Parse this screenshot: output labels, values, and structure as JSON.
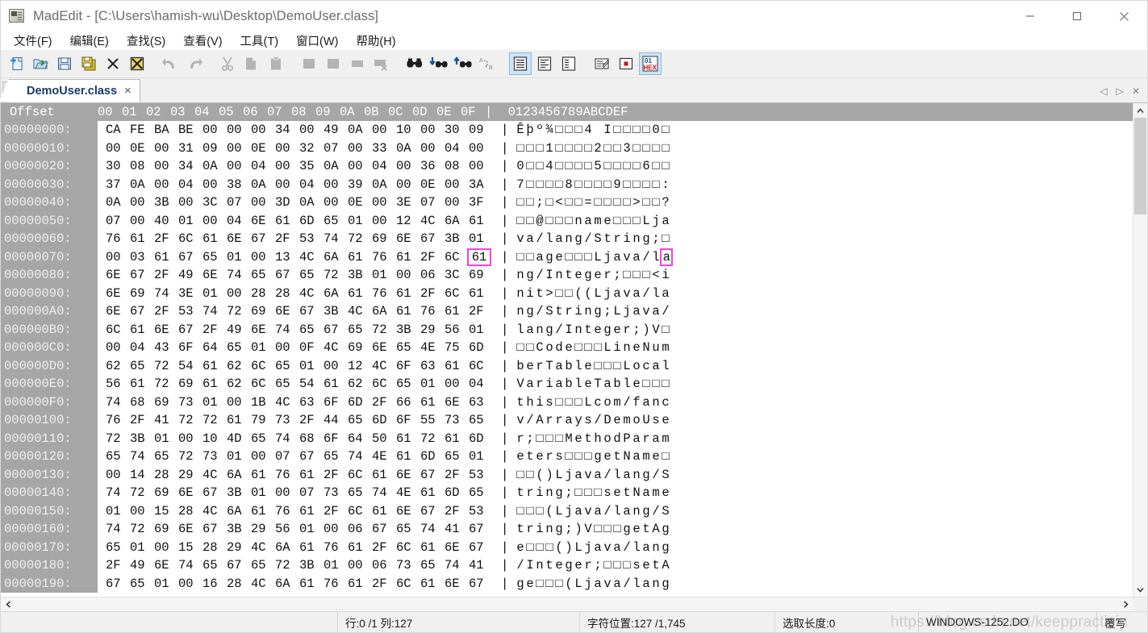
{
  "window": {
    "title": "MadEdit - [C:\\Users\\hamish-wu\\Desktop\\DemoUser.class]",
    "app_icon": "madedit-app-icon",
    "minimize_label": "—",
    "maximize_label": "☐",
    "close_label": "✕"
  },
  "menu": {
    "items": [
      {
        "label": "文件(F)"
      },
      {
        "label": "编辑(E)"
      },
      {
        "label": "查找(S)"
      },
      {
        "label": "查看(V)"
      },
      {
        "label": "工具(T)"
      },
      {
        "label": "窗口(W)"
      },
      {
        "label": "帮助(H)"
      }
    ]
  },
  "toolbar": {
    "items": [
      {
        "name": "new-file-icon",
        "enabled": true
      },
      {
        "name": "open-file-icon",
        "enabled": true
      },
      {
        "name": "save-file-icon",
        "enabled": true
      },
      {
        "name": "save-all-icon",
        "enabled": true
      },
      {
        "name": "close-file-icon",
        "enabled": true
      },
      {
        "name": "close-all-icon",
        "enabled": true
      },
      {
        "name": "separator-1",
        "separator": true
      },
      {
        "name": "undo-icon",
        "enabled": false
      },
      {
        "name": "redo-icon",
        "enabled": false
      },
      {
        "name": "separator-2",
        "separator": true
      },
      {
        "name": "cut-icon",
        "enabled": false
      },
      {
        "name": "copy-icon",
        "enabled": false
      },
      {
        "name": "paste-icon",
        "enabled": false
      },
      {
        "name": "separator-3",
        "separator": true
      },
      {
        "name": "indent-icon",
        "enabled": false
      },
      {
        "name": "unindent-icon",
        "enabled": false
      },
      {
        "name": "comment-icon",
        "enabled": false
      },
      {
        "name": "uncomment-icon",
        "enabled": false
      },
      {
        "name": "separator-4",
        "separator": true
      },
      {
        "name": "find-icon",
        "enabled": true
      },
      {
        "name": "find-next-icon",
        "enabled": true
      },
      {
        "name": "find-previous-icon",
        "enabled": true
      },
      {
        "name": "replace-icon",
        "enabled": true
      },
      {
        "name": "separator-5",
        "separator": true
      },
      {
        "name": "word-wrap-by-window-icon",
        "enabled": true,
        "active": true
      },
      {
        "name": "word-wrap-by-column-icon",
        "enabled": true
      },
      {
        "name": "no-word-wrap-icon",
        "enabled": true
      },
      {
        "name": "separator-6",
        "separator": true
      },
      {
        "name": "text-mode-icon",
        "enabled": true
      },
      {
        "name": "column-mode-icon",
        "enabled": true
      },
      {
        "name": "hex-mode-icon",
        "enabled": true,
        "active": true
      }
    ]
  },
  "tabs": {
    "left_stub": "",
    "items": [
      {
        "label": "DemoUser.class",
        "close": "×",
        "active": true
      }
    ],
    "nav_prev": "◁",
    "nav_next": "▷",
    "nav_close": "✕"
  },
  "hex_view": {
    "header": {
      "offset_label": "Offset",
      "byte_columns": [
        "00",
        "01",
        "02",
        "03",
        "04",
        "05",
        "06",
        "07",
        "08",
        "09",
        "0A",
        "0B",
        "0C",
        "0D",
        "0E",
        "0F"
      ],
      "separator": "|",
      "ascii_label": "0123456789ABCDEF"
    },
    "cursor": {
      "row_index": 7,
      "byte_index": 15,
      "color": "#ee44dd"
    },
    "rows": [
      {
        "offset": "00000000:",
        "bytes": [
          "CA",
          "FE",
          "BA",
          "BE",
          "00",
          "00",
          "00",
          "34",
          "00",
          "49",
          "0A",
          "00",
          "10",
          "00",
          "30",
          "09"
        ],
        "ascii": "Êþº¾□□□4 I□□□□0□"
      },
      {
        "offset": "00000010:",
        "bytes": [
          "00",
          "0E",
          "00",
          "31",
          "09",
          "00",
          "0E",
          "00",
          "32",
          "07",
          "00",
          "33",
          "0A",
          "00",
          "04",
          "00"
        ],
        "ascii": "□□□1□□□□2□□3□□□□"
      },
      {
        "offset": "00000020:",
        "bytes": [
          "30",
          "08",
          "00",
          "34",
          "0A",
          "00",
          "04",
          "00",
          "35",
          "0A",
          "00",
          "04",
          "00",
          "36",
          "08",
          "00"
        ],
        "ascii": "0□□4□□□□5□□□□6□□"
      },
      {
        "offset": "00000030:",
        "bytes": [
          "37",
          "0A",
          "00",
          "04",
          "00",
          "38",
          "0A",
          "00",
          "04",
          "00",
          "39",
          "0A",
          "00",
          "0E",
          "00",
          "3A"
        ],
        "ascii": "7□□□□8□□□□9□□□□:"
      },
      {
        "offset": "00000040:",
        "bytes": [
          "0A",
          "00",
          "3B",
          "00",
          "3C",
          "07",
          "00",
          "3D",
          "0A",
          "00",
          "0E",
          "00",
          "3E",
          "07",
          "00",
          "3F"
        ],
        "ascii": "□□;□<□□=□□□□>□□?"
      },
      {
        "offset": "00000050:",
        "bytes": [
          "07",
          "00",
          "40",
          "01",
          "00",
          "04",
          "6E",
          "61",
          "6D",
          "65",
          "01",
          "00",
          "12",
          "4C",
          "6A",
          "61"
        ],
        "ascii": "□□@□□□name□□□Lja"
      },
      {
        "offset": "00000060:",
        "bytes": [
          "76",
          "61",
          "2F",
          "6C",
          "61",
          "6E",
          "67",
          "2F",
          "53",
          "74",
          "72",
          "69",
          "6E",
          "67",
          "3B",
          "01"
        ],
        "ascii": "va/lang/String;□"
      },
      {
        "offset": "00000070:",
        "bytes": [
          "00",
          "03",
          "61",
          "67",
          "65",
          "01",
          "00",
          "13",
          "4C",
          "6A",
          "61",
          "76",
          "61",
          "2F",
          "6C",
          "61"
        ],
        "ascii": "□□age□□□Ljava/la"
      },
      {
        "offset": "00000080:",
        "bytes": [
          "6E",
          "67",
          "2F",
          "49",
          "6E",
          "74",
          "65",
          "67",
          "65",
          "72",
          "3B",
          "01",
          "00",
          "06",
          "3C",
          "69"
        ],
        "ascii": "ng/Integer;□□□<i"
      },
      {
        "offset": "00000090:",
        "bytes": [
          "6E",
          "69",
          "74",
          "3E",
          "01",
          "00",
          "28",
          "28",
          "4C",
          "6A",
          "61",
          "76",
          "61",
          "2F",
          "6C",
          "61"
        ],
        "ascii": "nit>□□((Ljava/la"
      },
      {
        "offset": "000000A0:",
        "bytes": [
          "6E",
          "67",
          "2F",
          "53",
          "74",
          "72",
          "69",
          "6E",
          "67",
          "3B",
          "4C",
          "6A",
          "61",
          "76",
          "61",
          "2F"
        ],
        "ascii": "ng/String;Ljava/"
      },
      {
        "offset": "000000B0:",
        "bytes": [
          "6C",
          "61",
          "6E",
          "67",
          "2F",
          "49",
          "6E",
          "74",
          "65",
          "67",
          "65",
          "72",
          "3B",
          "29",
          "56",
          "01"
        ],
        "ascii": "lang/Integer;)V□"
      },
      {
        "offset": "000000C0:",
        "bytes": [
          "00",
          "04",
          "43",
          "6F",
          "64",
          "65",
          "01",
          "00",
          "0F",
          "4C",
          "69",
          "6E",
          "65",
          "4E",
          "75",
          "6D"
        ],
        "ascii": "□□Code□□□LineNum"
      },
      {
        "offset": "000000D0:",
        "bytes": [
          "62",
          "65",
          "72",
          "54",
          "61",
          "62",
          "6C",
          "65",
          "01",
          "00",
          "12",
          "4C",
          "6F",
          "63",
          "61",
          "6C"
        ],
        "ascii": "berTable□□□Local"
      },
      {
        "offset": "000000E0:",
        "bytes": [
          "56",
          "61",
          "72",
          "69",
          "61",
          "62",
          "6C",
          "65",
          "54",
          "61",
          "62",
          "6C",
          "65",
          "01",
          "00",
          "04"
        ],
        "ascii": "VariableTable□□□"
      },
      {
        "offset": "000000F0:",
        "bytes": [
          "74",
          "68",
          "69",
          "73",
          "01",
          "00",
          "1B",
          "4C",
          "63",
          "6F",
          "6D",
          "2F",
          "66",
          "61",
          "6E",
          "63"
        ],
        "ascii": "this□□□Lcom/fanc"
      },
      {
        "offset": "00000100:",
        "bytes": [
          "76",
          "2F",
          "41",
          "72",
          "72",
          "61",
          "79",
          "73",
          "2F",
          "44",
          "65",
          "6D",
          "6F",
          "55",
          "73",
          "65"
        ],
        "ascii": "v/Arrays/DemoUse"
      },
      {
        "offset": "00000110:",
        "bytes": [
          "72",
          "3B",
          "01",
          "00",
          "10",
          "4D",
          "65",
          "74",
          "68",
          "6F",
          "64",
          "50",
          "61",
          "72",
          "61",
          "6D"
        ],
        "ascii": "r;□□□MethodParam"
      },
      {
        "offset": "00000120:",
        "bytes": [
          "65",
          "74",
          "65",
          "72",
          "73",
          "01",
          "00",
          "07",
          "67",
          "65",
          "74",
          "4E",
          "61",
          "6D",
          "65",
          "01"
        ],
        "ascii": "eters□□□getName□"
      },
      {
        "offset": "00000130:",
        "bytes": [
          "00",
          "14",
          "28",
          "29",
          "4C",
          "6A",
          "61",
          "76",
          "61",
          "2F",
          "6C",
          "61",
          "6E",
          "67",
          "2F",
          "53"
        ],
        "ascii": "□□()Ljava/lang/S"
      },
      {
        "offset": "00000140:",
        "bytes": [
          "74",
          "72",
          "69",
          "6E",
          "67",
          "3B",
          "01",
          "00",
          "07",
          "73",
          "65",
          "74",
          "4E",
          "61",
          "6D",
          "65"
        ],
        "ascii": "tring;□□□setName"
      },
      {
        "offset": "00000150:",
        "bytes": [
          "01",
          "00",
          "15",
          "28",
          "4C",
          "6A",
          "61",
          "76",
          "61",
          "2F",
          "6C",
          "61",
          "6E",
          "67",
          "2F",
          "53"
        ],
        "ascii": "□□□(Ljava/lang/S"
      },
      {
        "offset": "00000160:",
        "bytes": [
          "74",
          "72",
          "69",
          "6E",
          "67",
          "3B",
          "29",
          "56",
          "01",
          "00",
          "06",
          "67",
          "65",
          "74",
          "41",
          "67"
        ],
        "ascii": "tring;)V□□□getAg"
      },
      {
        "offset": "00000170:",
        "bytes": [
          "65",
          "01",
          "00",
          "15",
          "28",
          "29",
          "4C",
          "6A",
          "61",
          "76",
          "61",
          "2F",
          "6C",
          "61",
          "6E",
          "67"
        ],
        "ascii": "e□□□()Ljava/lang"
      },
      {
        "offset": "00000180:",
        "bytes": [
          "2F",
          "49",
          "6E",
          "74",
          "65",
          "67",
          "65",
          "72",
          "3B",
          "01",
          "00",
          "06",
          "73",
          "65",
          "74",
          "41"
        ],
        "ascii": "/Integer;□□□setA"
      },
      {
        "offset": "00000190:",
        "bytes": [
          "67",
          "65",
          "01",
          "00",
          "16",
          "28",
          "4C",
          "6A",
          "61",
          "76",
          "61",
          "2F",
          "6C",
          "61",
          "6E",
          "67"
        ],
        "ascii": "ge□□□(Ljava/lang"
      }
    ]
  },
  "scrollbars": {
    "v_up": "⌃",
    "v_down": "⌄",
    "h_left": "‹",
    "h_right": "›"
  },
  "statusbar": {
    "empty_left": "",
    "line_col": "行:0 /1 列:127",
    "char_pos": "字符位置:127 /1,745",
    "sel_len": "选取长度:0",
    "encoding": "WINDOWS-1252.DO",
    "overwrite_mode": "覆写"
  },
  "watermark": {
    "text": "https://blog.csdn.net/keeppracticin"
  }
}
